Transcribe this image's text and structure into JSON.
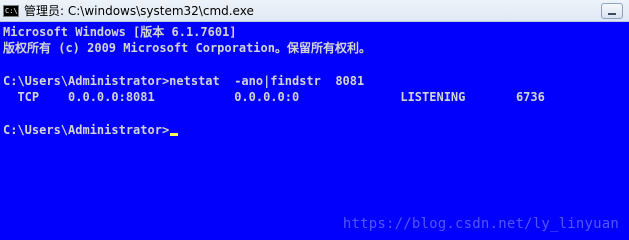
{
  "window": {
    "icon_text": "C:\\",
    "title": "管理员: C:\\windows\\system32\\cmd.exe"
  },
  "console": {
    "lines": [
      "Microsoft Windows [版本 6.1.7601]",
      "版权所有 (c) 2009 Microsoft Corporation。保留所有权利。",
      "",
      "C:\\Users\\Administrator>netstat  -ano|findstr  8081",
      "  TCP    0.0.0.0:8081           0.0.0.0:0              LISTENING       6736",
      "",
      "C:\\Users\\Administrator>"
    ]
  },
  "watermark": "https://blog.csdn.net/ly_linyuan",
  "colors": {
    "console_background": "#0000fc",
    "console_text": "#d4d4d4",
    "cursor": "#ffff54"
  }
}
